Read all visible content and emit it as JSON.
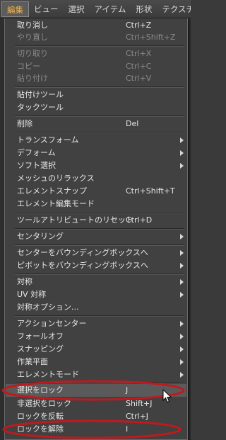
{
  "menubar": {
    "items": [
      "編集",
      "ビュー",
      "選択",
      "アイテム",
      "形状",
      "テクスチャ"
    ]
  },
  "menu": {
    "undo": {
      "label": "取り消し",
      "shortcut": "Ctrl+Z"
    },
    "redo": {
      "label": "やり直し",
      "shortcut": "Ctrl+Shift+Z"
    },
    "cut": {
      "label": "切り取り",
      "shortcut": "Ctrl+X"
    },
    "copy": {
      "label": "コピー",
      "shortcut": "Ctrl+C"
    },
    "paste": {
      "label": "貼り付け",
      "shortcut": "Ctrl+V"
    },
    "paste_tool": {
      "label": "貼付けツール"
    },
    "tack_tool": {
      "label": "タックツール"
    },
    "delete": {
      "label": "削除",
      "shortcut": "Del"
    },
    "transform": {
      "label": "トランスフォーム"
    },
    "deform": {
      "label": "デフォーム"
    },
    "soft_select": {
      "label": "ソフト選択"
    },
    "mesh_relax": {
      "label": "メッシュのリラックス"
    },
    "element_snap": {
      "label": "エレメントスナップ",
      "shortcut": "Ctrl+Shift+T"
    },
    "element_edit_mode": {
      "label": "エレメント編集モード"
    },
    "reset_tool_attrs": {
      "label": "ツールアトリビュートのリセット",
      "shortcut": "Ctrl+D"
    },
    "centering": {
      "label": "センタリング"
    },
    "center_to_bbox": {
      "label": "センターをバウンディングボックスへ"
    },
    "pivot_to_bbox": {
      "label": "ピボットをバウンディングボックスへ"
    },
    "symmetry": {
      "label": "対称"
    },
    "uv_symmetry": {
      "label": "UV 対称"
    },
    "symmetry_options": {
      "label": "対称オプション..."
    },
    "action_center": {
      "label": "アクションセンター"
    },
    "falloff": {
      "label": "フォールオフ"
    },
    "snapping": {
      "label": "スナッピング"
    },
    "work_plane": {
      "label": "作業平面"
    },
    "element_mode": {
      "label": "エレメントモード"
    },
    "lock_selected": {
      "label": "選択をロック",
      "shortcut": "J"
    },
    "lock_unselected": {
      "label": "非選択をロック",
      "shortcut": "Shift+J"
    },
    "invert_lock": {
      "label": "ロックを反転",
      "shortcut": "Ctrl+J"
    },
    "unlock": {
      "label": "ロックを解除",
      "shortcut": "I"
    }
  },
  "colors": {
    "menu_bg": "#414141",
    "active_menu_text": "#f0b44a",
    "annotation_red": "#c0191e"
  }
}
